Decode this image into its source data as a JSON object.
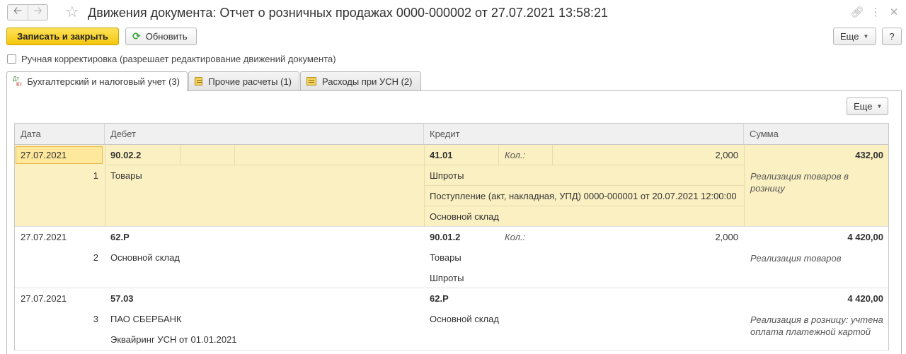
{
  "window": {
    "title": "Движения документа: Отчет о розничных продажах 0000-000002 от 27.07.2021 13:58:21",
    "icons": [
      "link-icon",
      "more-vertical-icon",
      "close-icon"
    ]
  },
  "toolbar": {
    "save_close_label": "Записать и закрыть",
    "refresh_label": "Обновить",
    "more_label": "Еще",
    "help_label": "?"
  },
  "manual_edit": {
    "label": "Ручная корректировка (разрешает редактирование движений документа)",
    "checked": false
  },
  "tabs": [
    {
      "label": "Бухгалтерский и налоговый учет (3)",
      "active": true
    },
    {
      "label": "Прочие расчеты (1)",
      "active": false
    },
    {
      "label": "Расходы при УСН (2)",
      "active": false
    }
  ],
  "panel": {
    "more_label": "Еще"
  },
  "table": {
    "columns": [
      "Дата",
      "Дебет",
      "Кредит",
      "Сумма"
    ],
    "rows": [
      {
        "date": "27.07.2021",
        "num": "1",
        "debit_account": "90.02.2",
        "debit_sub": [
          "Товары"
        ],
        "credit_account": "41.01",
        "qty_label": "Кол.:",
        "qty": "2,000",
        "credit_sub": [
          "Шпроты",
          "Поступление (акт, накладная, УПД) 0000-000001 от 20.07.2021 12:00:00",
          "Основной склад"
        ],
        "amount": "432,00",
        "content": "Реализация товаров в розницу"
      },
      {
        "date": "27.07.2021",
        "num": "2",
        "debit_account": "62.Р",
        "debit_sub": [
          "Основной склад"
        ],
        "credit_account": "90.01.2",
        "qty_label": "Кол.:",
        "qty": "2,000",
        "credit_sub": [
          "Товары",
          "Шпроты"
        ],
        "amount": "4 420,00",
        "content": "Реализация товаров"
      },
      {
        "date": "27.07.2021",
        "num": "3",
        "debit_account": "57.03",
        "debit_sub": [
          "ПАО СБЕРБАНК",
          "Эквайринг УСН от 01.01.2021"
        ],
        "credit_account": "62.Р",
        "credit_sub": [
          "Основной склад"
        ],
        "amount": "4 420,00",
        "content": "Реализация в розницу: учтена оплата платежной картой"
      }
    ]
  }
}
